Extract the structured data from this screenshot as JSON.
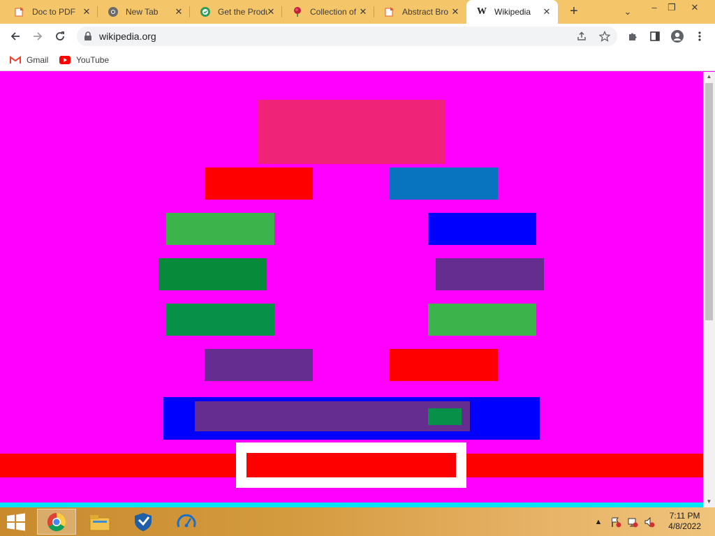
{
  "browser": {
    "tabs": [
      {
        "title": "Doc to PDF",
        "icon": "doc-to-pdf-icon",
        "active": false
      },
      {
        "title": "New Tab",
        "icon": "chrome-icon",
        "active": false
      },
      {
        "title": "Get the Produ",
        "icon": "shield-check-icon",
        "active": false
      },
      {
        "title": "Collection of",
        "icon": "rose-icon",
        "active": false
      },
      {
        "title": "Abstract Bro",
        "icon": "doc-to-pdf-icon",
        "active": false
      },
      {
        "title": "Wikipedia",
        "icon": "wikipedia-w-icon",
        "active": true
      }
    ],
    "address": {
      "url": "wikipedia.org"
    },
    "bookmarks": [
      {
        "label": "Gmail",
        "icon": "gmail-icon"
      },
      {
        "label": "YouTube",
        "icon": "youtube-icon"
      }
    ],
    "tab_close_glyph": "✕",
    "new_tab_glyph": "+",
    "window_controls": {
      "tab_list": "⌄",
      "minimize": "–",
      "restore": "❐",
      "close": "✕"
    }
  },
  "page": {
    "background": "#ff00ff",
    "blocks": [
      {
        "name": "pink-block",
        "color": "#ef2378"
      },
      {
        "name": "red-block-left",
        "color": "#ff0000"
      },
      {
        "name": "blue-block-right",
        "color": "#0874bf"
      },
      {
        "name": "green-block-left-1",
        "color": "#3cb44b"
      },
      {
        "name": "blue-block-right-2",
        "color": "#0000ff"
      },
      {
        "name": "dark-green-block-left",
        "color": "#078a3a"
      },
      {
        "name": "purple-block-right",
        "color": "#662d91"
      },
      {
        "name": "dark-green-block-left-2",
        "color": "#079148"
      },
      {
        "name": "green-block-right",
        "color": "#3cb44b"
      },
      {
        "name": "purple-block-left",
        "color": "#662d91"
      },
      {
        "name": "red-block-right",
        "color": "#ff0000"
      },
      {
        "name": "blue-wide-bar",
        "color": "#0000ff"
      },
      {
        "name": "purple-inner-bar",
        "color": "#662d91"
      },
      {
        "name": "green-small-button",
        "color": "#079148"
      },
      {
        "name": "red-footer-bar",
        "color": "#ff0000"
      },
      {
        "name": "white-frame",
        "color": "#ffffff"
      },
      {
        "name": "red-inner-bar",
        "color": "#ff0000"
      }
    ],
    "bottom_strip_color": "#00e5f5"
  },
  "taskbar": {
    "apps": [
      {
        "name": "chrome-taskbar-icon",
        "active": true
      },
      {
        "name": "file-explorer-icon",
        "active": false
      },
      {
        "name": "security-shield-icon",
        "active": false
      },
      {
        "name": "speedometer-icon",
        "active": false
      }
    ],
    "clock": {
      "time": "7:11 PM",
      "date": "4/8/2022"
    }
  }
}
